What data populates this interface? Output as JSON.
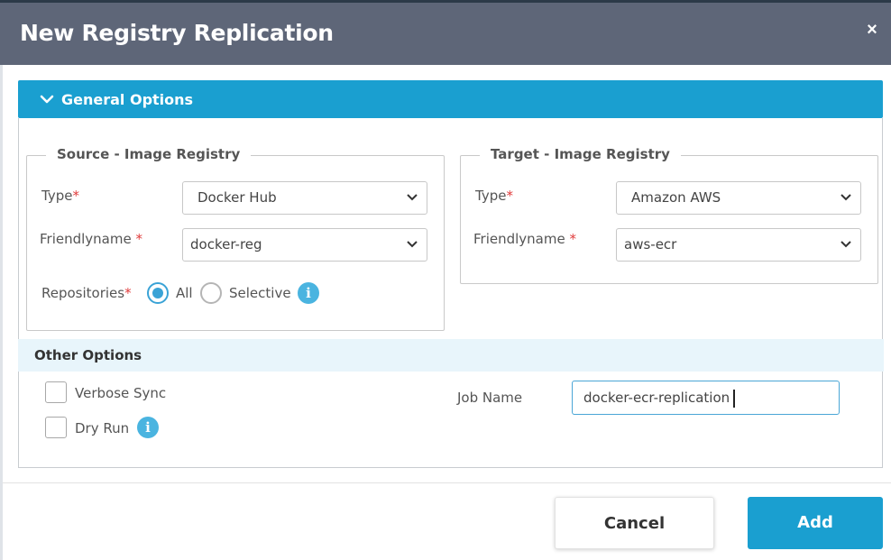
{
  "dialog": {
    "title": "New Registry Replication",
    "close_glyph": "×"
  },
  "general_options": {
    "title": "General Options",
    "chevron_icon": "chevron-down-icon"
  },
  "source": {
    "legend": "Source - Image Registry",
    "type_label": "Type",
    "type_value": "Docker Hub",
    "friendlyname_label": "Friendlyname",
    "friendlyname_value": "docker-reg",
    "repositories_label": "Repositories",
    "option_all": "All",
    "option_selective": "Selective",
    "selected_option": "All",
    "required_mark": "*"
  },
  "target": {
    "legend": "Target - Image Registry",
    "type_label": "Type",
    "type_value": "Amazon AWS",
    "friendlyname_label": "Friendlyname",
    "friendlyname_value": "aws-ecr",
    "required_mark": "*"
  },
  "other_options": {
    "title": "Other Options",
    "verbose_sync_label": "Verbose Sync",
    "verbose_sync_checked": false,
    "dry_run_label": "Dry Run",
    "dry_run_checked": false,
    "job_name_label": "Job Name",
    "job_name_value": "docker-ecr-replication"
  },
  "footer": {
    "cancel_label": "Cancel",
    "add_label": "Add"
  },
  "colors": {
    "header_bg": "#5e6678",
    "accent": "#1a9fd0",
    "required": "#e03a3a",
    "info": "#4ab4e0"
  }
}
